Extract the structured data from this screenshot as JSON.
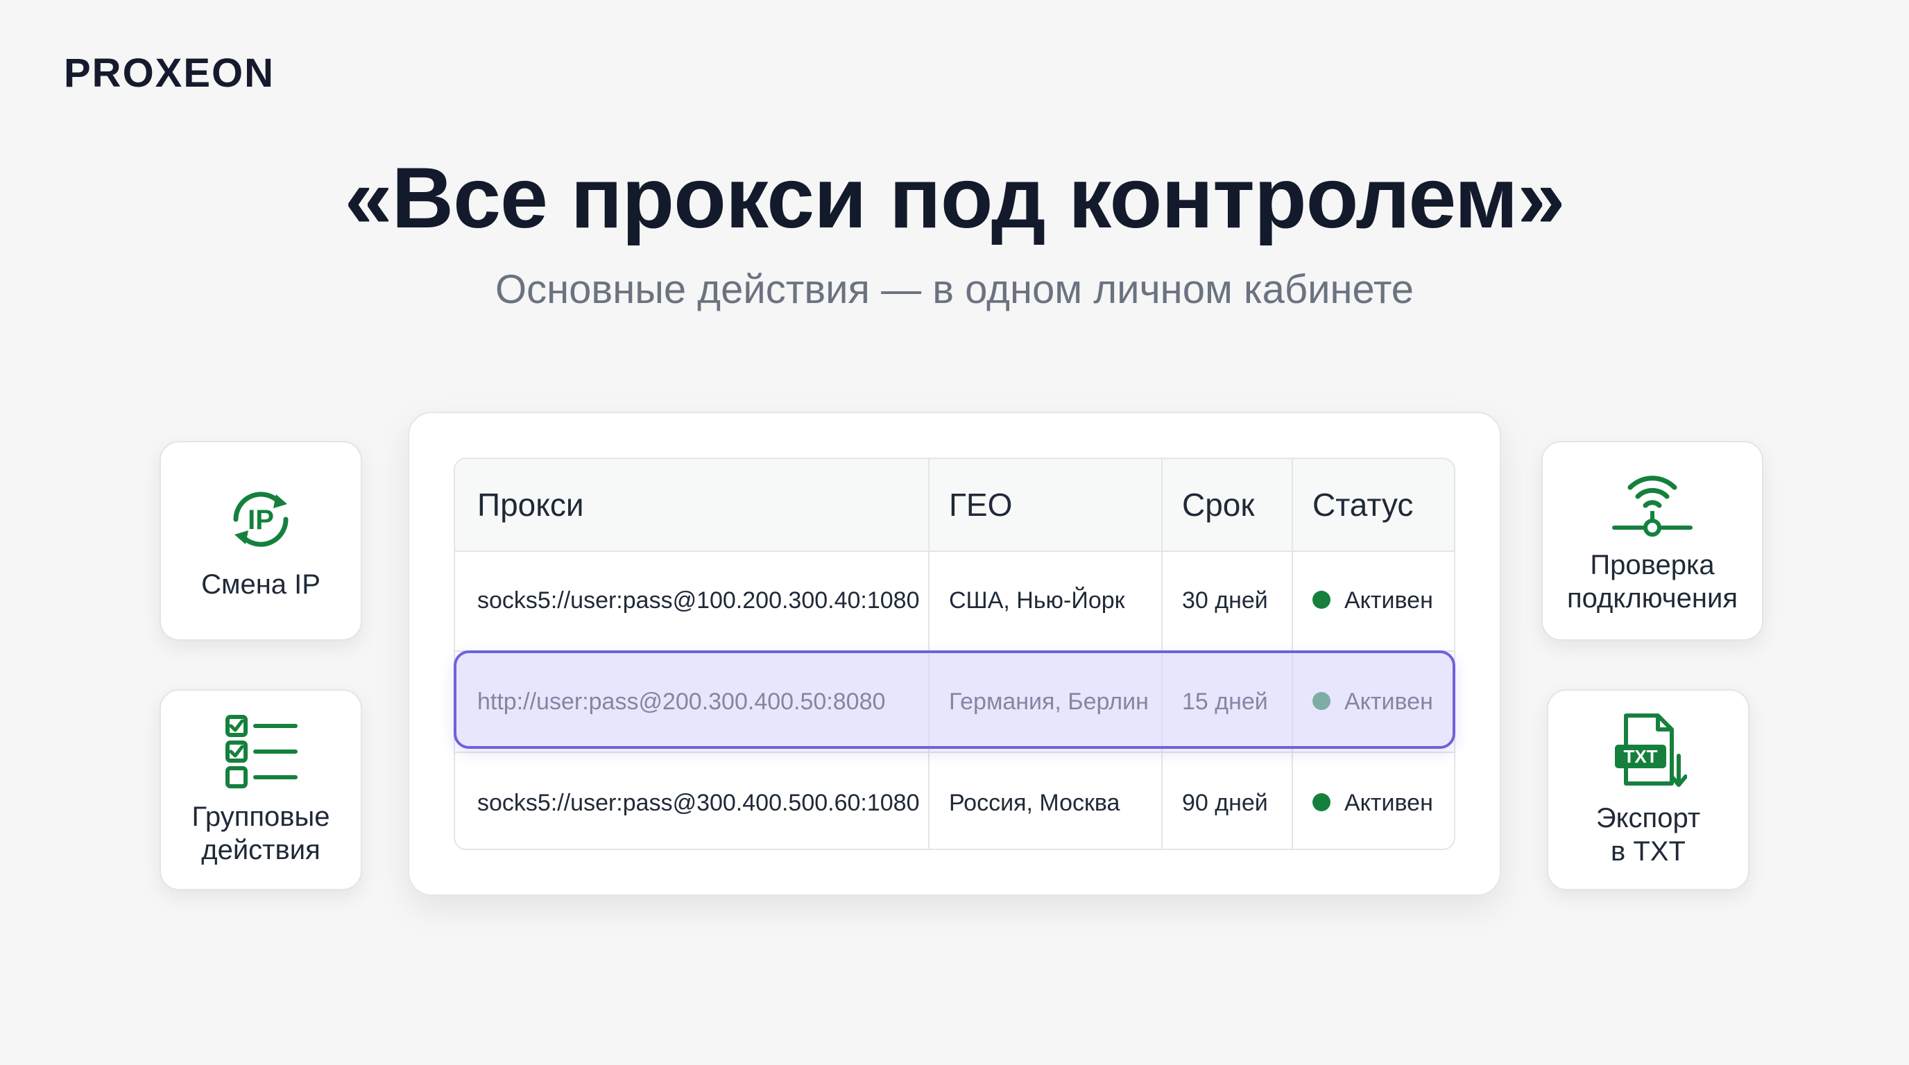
{
  "brand": {
    "name": "PROXEON"
  },
  "hero": {
    "title": "«Все прокси под контролем»",
    "subtitle": "Основные действия — в одном личном кабинете"
  },
  "features": {
    "change_ip": {
      "label": "Смена IP",
      "icon": "ip-refresh-icon",
      "icon_text": "IP"
    },
    "bulk_actions": {
      "label": "Групповые\nдействия",
      "icon": "checklist-icon"
    },
    "connection_check": {
      "label": "Проверка\nподключения",
      "icon": "wifi-network-icon"
    },
    "export_txt": {
      "label": "Экспорт\nв TXT",
      "icon": "txt-file-download-icon",
      "icon_text": "TXT"
    }
  },
  "table": {
    "headers": [
      "Прокси",
      "ГЕО",
      "Срок",
      "Статус"
    ],
    "rows": [
      {
        "proxy": "socks5://user:pass@100.200.300.40:1080",
        "geo": "США, Нью-Йорк",
        "term": "30 дней",
        "status": "Активен"
      },
      {
        "proxy": "http://user:pass@200.300.400.50:8080",
        "geo": "Германия, Берлин",
        "term": "15 дней",
        "status": "Активен"
      },
      {
        "proxy": "socks5://user:pass@300.400.500.60:1080",
        "geo": "Россия, Москва",
        "term": "90 дней",
        "status": "Активен"
      }
    ],
    "selected_row": 1
  },
  "colors": {
    "accent_green": "#15803d",
    "status_active": "#15803d",
    "selection_border": "#6e62dc",
    "selection_fill": "#e3e0fd",
    "heading": "#131a2b",
    "subtitle": "#6b7280",
    "background": "#f5f6f5"
  }
}
